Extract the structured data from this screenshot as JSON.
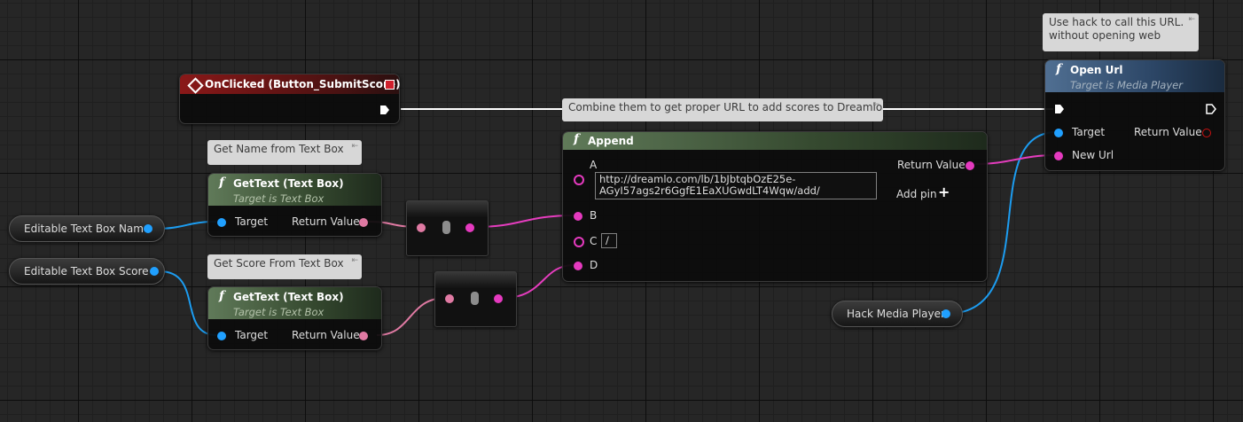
{
  "comments": {
    "open_url": "Use hack to call this URL.\nwithout opening web",
    "combine": "Combine them to get proper URL to add scores to Dreamlo",
    "get_name": "Get Name from Text Box",
    "get_score": "Get Score From Text Box"
  },
  "event_node": {
    "title": "OnClicked (Button_SubmitScore)"
  },
  "get_text_name": {
    "title": "GetText (Text Box)",
    "subtitle": "Target is Text Box",
    "in_pin": "Target",
    "out_pin": "Return Value"
  },
  "get_text_score": {
    "title": "GetText (Text Box)",
    "subtitle": "Target is Text Box",
    "in_pin": "Target",
    "out_pin": "Return Value"
  },
  "append": {
    "title": "Append",
    "pin_a": "A",
    "pin_a_value": "http://dreamlo.com/lb/1bJbtqbOzE25e-\nAGyI57ags2r6GgfE1EaXUGwdLT4Wqw/add/",
    "pin_b": "B",
    "pin_c": "C",
    "pin_c_value": "/",
    "pin_d": "D",
    "out_pin": "Return Value",
    "add_pin": "Add pin"
  },
  "open_url": {
    "title": "Open Url",
    "subtitle": "Target is Media Player",
    "target": "Target",
    "new_url": "New Url",
    "out_pin": "Return Value"
  },
  "variables": {
    "name_box": "Editable Text Box Name",
    "score_box": "Editable Text Box Score",
    "media_player": "Hack Media Player"
  },
  "colors": {
    "exec_wire": "#ffffff",
    "object_wire": "#1c9cf0",
    "string_wire": "#e63dbf",
    "text_wire": "#e07aa3",
    "event_header": "#8a1818",
    "function_header": "#607a59",
    "target_function_header": "#506f92"
  },
  "icons": {
    "event": "event-diamond-icon",
    "function": "function-icon",
    "exec": "exec-arrow-icon",
    "add": "plus-icon"
  }
}
